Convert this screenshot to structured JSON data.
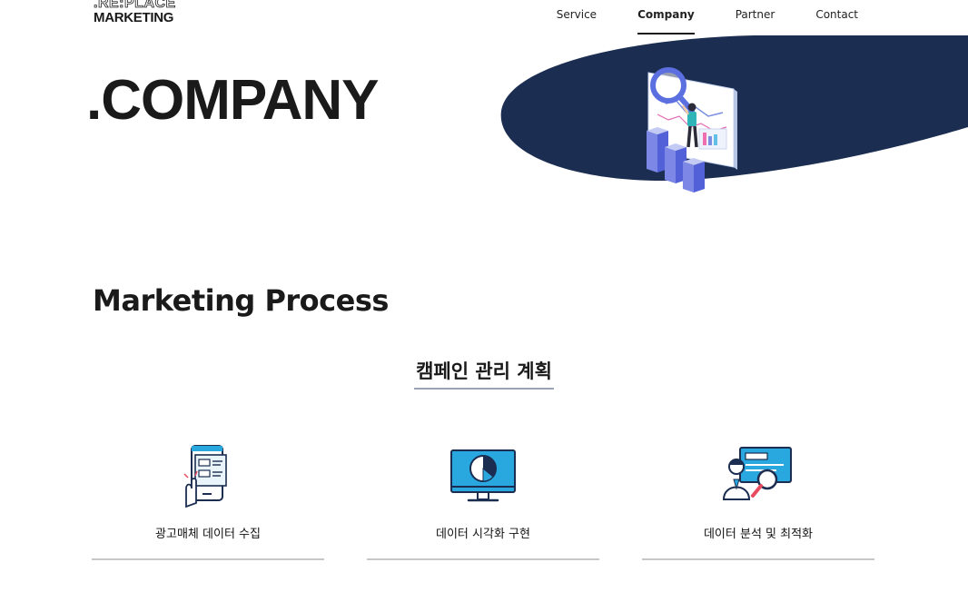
{
  "header": {
    "logo_top": ".RE:PLACE",
    "logo_bottom": "MARKETING",
    "nav": [
      {
        "label": "Service",
        "active": false
      },
      {
        "label": "Company",
        "active": true
      },
      {
        "label": "Partner",
        "active": false
      },
      {
        "label": "Contact",
        "active": false
      }
    ]
  },
  "hero": {
    "title": ".COMPANY",
    "shape_color": "#1b2d50"
  },
  "process": {
    "title": "Marketing Process",
    "subtitle": "캠페인 관리 계획",
    "cards": [
      {
        "label": "광고매체 데이터 수집",
        "icon": "mobile-data-icon"
      },
      {
        "label": "데이터 시각화 구현",
        "icon": "monitor-pie-chart-icon"
      },
      {
        "label": "데이터 분석 및 최적화",
        "icon": "analyst-magnifier-icon"
      }
    ]
  },
  "colors": {
    "navy": "#1b2d50",
    "accent_blue": "#29a8e0",
    "text": "#1a1a1a",
    "divider": "#c8c8c8"
  }
}
